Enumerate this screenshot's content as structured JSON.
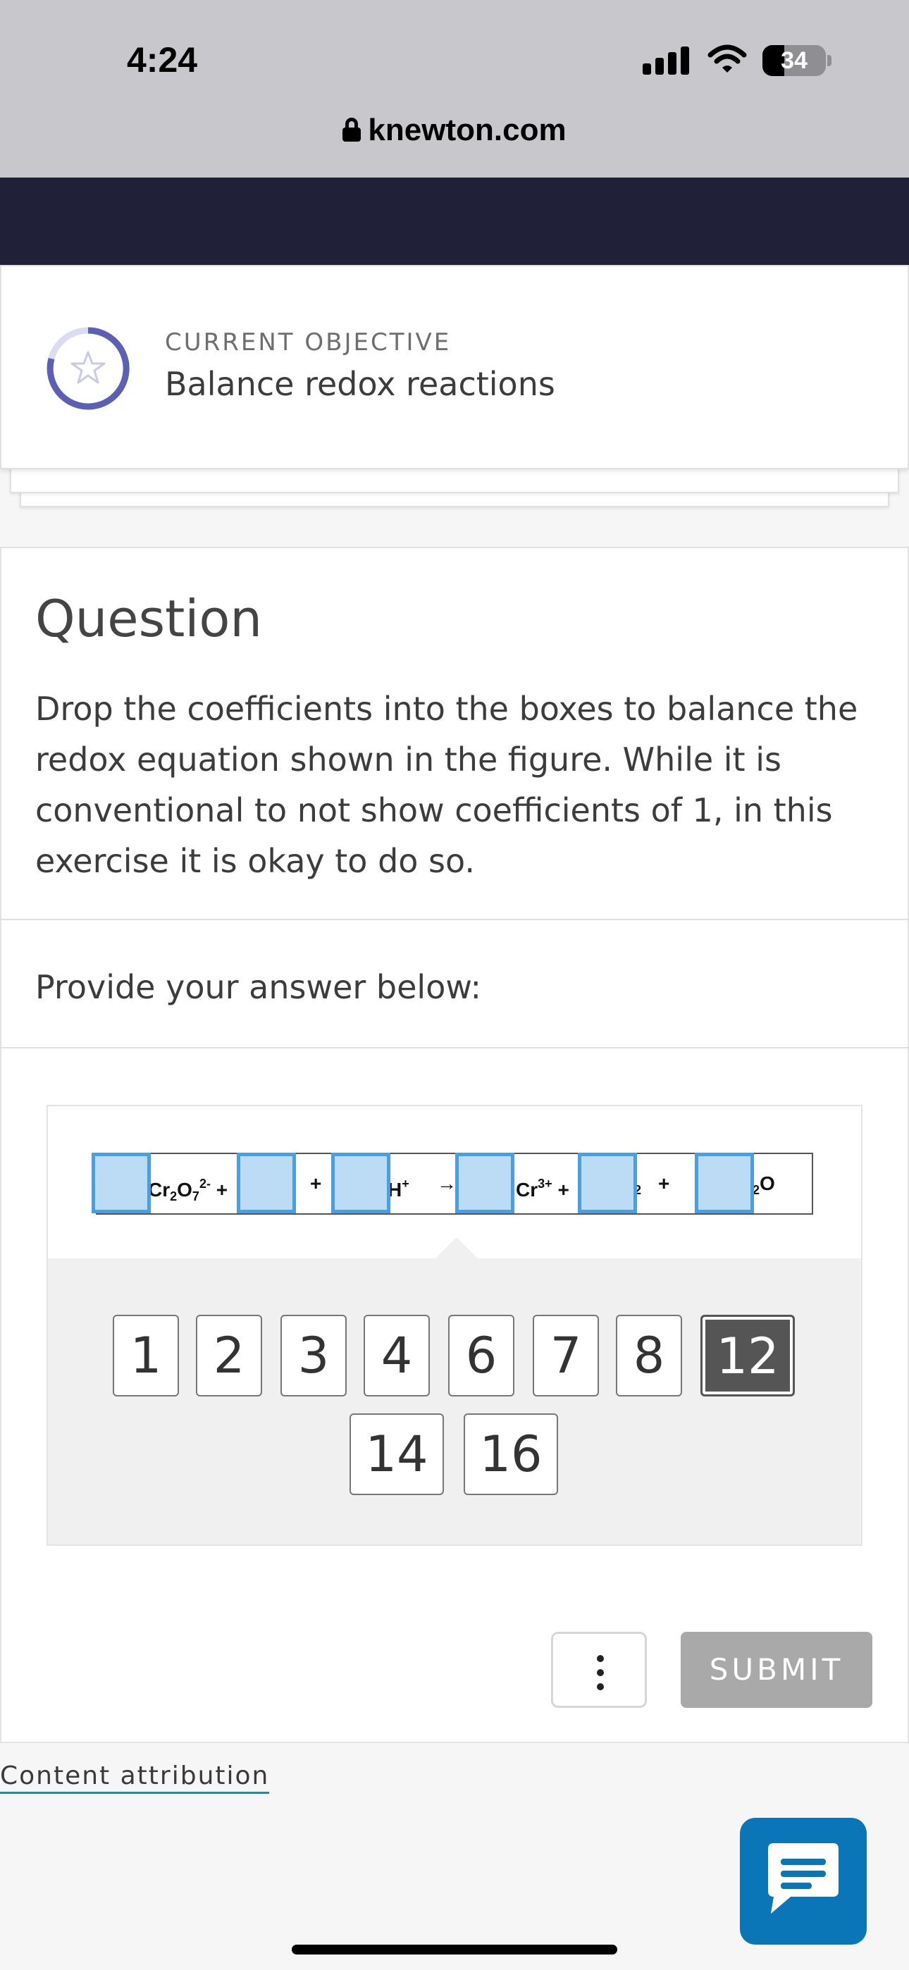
{
  "status_bar": {
    "time": "4:24",
    "battery": "34"
  },
  "browser": {
    "url": "knewton.com"
  },
  "objective": {
    "label": "CURRENT OBJECTIVE",
    "title": "Balance redox reactions"
  },
  "question": {
    "heading": "Question",
    "text": "Drop the coefficients into the boxes to balance the redox equation shown in the figure. While it is conventional to not show coefficients of 1, in this exercise it is okay to do so.",
    "provide_label": "Provide your answer below:"
  },
  "equation": {
    "arrow": "→",
    "plus": "+"
  },
  "coefficients": [
    "1",
    "2",
    "3",
    "4",
    "6",
    "7",
    "8",
    "12",
    "14",
    "16"
  ],
  "selected_coefficient": "12",
  "actions": {
    "submit_label": "SUBMIT"
  },
  "footer": {
    "attribution_label": "Content attribution"
  },
  "colors": {
    "nav_band": "#202039",
    "accent_ring": "#5b60b5",
    "drop_box_fill": "#bcdcf6",
    "drop_box_border": "#4b9fe0",
    "submit_disabled": "#a9a9a9",
    "chat_button": "#0a76b8"
  },
  "icons": [
    "lock-icon",
    "star-icon",
    "more-vertical-icon",
    "chat-icon",
    "signal-icon",
    "wifi-icon",
    "battery-icon"
  ]
}
